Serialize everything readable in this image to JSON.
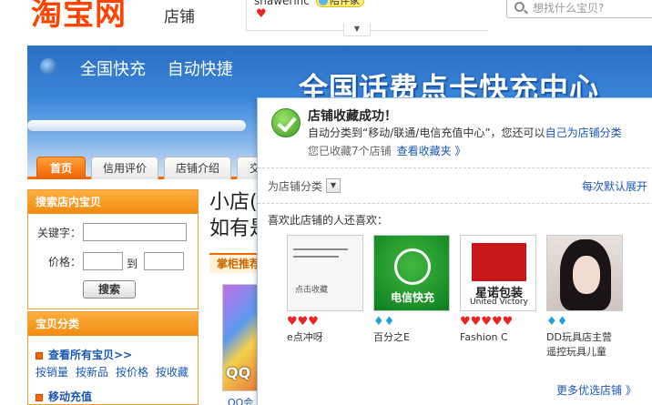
{
  "header": {
    "logo": "淘宝网",
    "logo_sub": "店铺",
    "username": "shawerinc",
    "badge": "陪伴家",
    "search_placeholder": "想找什么宝贝?"
  },
  "banner": {
    "nav": [
      "全国快充",
      "自动快捷"
    ],
    "title": "全国话费点卡快充中心"
  },
  "tabs": [
    "首页",
    "信用评价",
    "店铺介绍",
    "交"
  ],
  "left_panel": {
    "search_title": "搜索店内宝贝",
    "keyword_label": "关键字：",
    "price_label": "价格：",
    "to_label": "到",
    "search_button": "搜索",
    "category_title": "宝贝分类",
    "all_items": "查看所有宝贝>>",
    "sorts": [
      "按销量",
      "按新品",
      "按价格",
      "按收藏"
    ],
    "mobile_recharge": "移动充值"
  },
  "middle": {
    "title_line1": "小店(",
    "title_line2": "如有是",
    "tag": "掌柜推荐",
    "img_label": "QQ",
    "more": "QQ会"
  },
  "popup": {
    "title": "店铺收藏成功！",
    "line2_prefix": "自动分类到",
    "line2_category": "“移动/联通/电信充值中心”",
    "line2_mid": "，您还可以",
    "line2_link": "自己为店铺分类",
    "line3_text": "您已收藏7个店铺",
    "line3_link": "查看收藏夹 》",
    "category_label": "为店铺分类",
    "default_link": "每次默认展开",
    "like_label": "喜欢此店铺的人还喜欢：",
    "shops": [
      {
        "name": "e点冲呀",
        "rating": "♥♥♥",
        "rating_type": "heart",
        "img_text": "点击收藏"
      },
      {
        "name": "百分之E",
        "rating": "♦♦",
        "rating_type": "diamond",
        "img_text": "电信快充"
      },
      {
        "name": "Fashion C",
        "rating": "♥♥♥♥♥",
        "rating_type": "heart",
        "img_text": "星诺包装",
        "img_sub": "United Victory"
      },
      {
        "name": "DD玩具店主营\n遥控玩具儿童",
        "rating": "♦♦",
        "rating_type": "diamond",
        "img_text": ""
      }
    ],
    "more_link": "更多优选店铺 》"
  },
  "colors": {
    "brand": "#ff4400",
    "accent": "#f06000",
    "link": "#1a56b4",
    "banner": "#2a6fc4"
  }
}
